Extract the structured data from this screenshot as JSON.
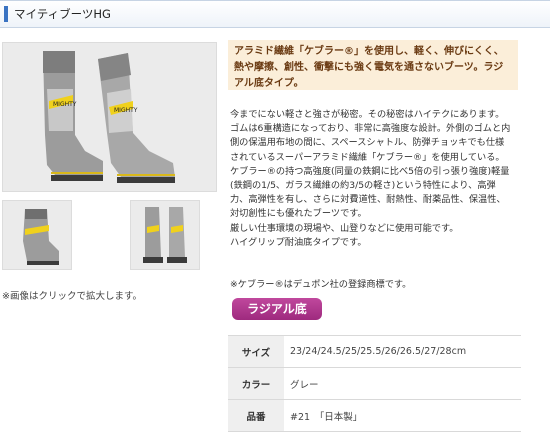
{
  "header": {
    "title": "マイティブーツHG"
  },
  "images": {
    "note": "※画像はクリックで拡大します。",
    "boot_label": "MIGHTY"
  },
  "colors": {
    "boot_gray": "#9a9a9a",
    "boot_light": "#c9c9c9",
    "boot_yellow": "#f0d11c",
    "badge": "#b03c8f",
    "highlight_bg": "#fbeed9"
  },
  "highlight": {
    "line1": "アラミド繊維「ケブラー®」を使用し、軽く、伸びにくく、",
    "line2": "熱や摩擦、創性、衝撃にも強く電気を通さないブーツ。ラジ",
    "line3": "アル底タイプ。"
  },
  "description": {
    "lines": [
      "今までにない軽さと強さが秘密。その秘密はハイテクにあります。",
      "ゴムは6重構造になっており、非常に高強度な設計。外側のゴムと内",
      "側の保温用布地の間に、スペースシャトル、防弾チョッキでも仕様",
      "されているスーパーアラミド繊維「ケブラー®」を使用している。",
      "ケブラー®の持つ高強度(同量の鉄鋼に比べ5倍の引っ張り強度)軽量",
      "(鉄鋼の1/5、ガラス繊維の約3/5の軽さ)という特性により、高弾",
      "力、高弾性を有し、さらに対費道性、耐熱性、耐薬品性、保温性、",
      "対切創性にも優れたブーツです。",
      "厳しい仕事環境の現場や、山登りなどに使用可能です。",
      "ハイグリップ耐油底タイプです。"
    ],
    "trademark": "※ケブラー®はデュポン社の登録商標です。"
  },
  "badge": {
    "label": "ラジアル底"
  },
  "specs": [
    {
      "key": "サイズ",
      "value": "23/24/24.5/25/25.5/26/26.5/27/28cm"
    },
    {
      "key": "カラー",
      "value": "グレー"
    },
    {
      "key": "品番",
      "value": "#21　「日本製」"
    }
  ]
}
